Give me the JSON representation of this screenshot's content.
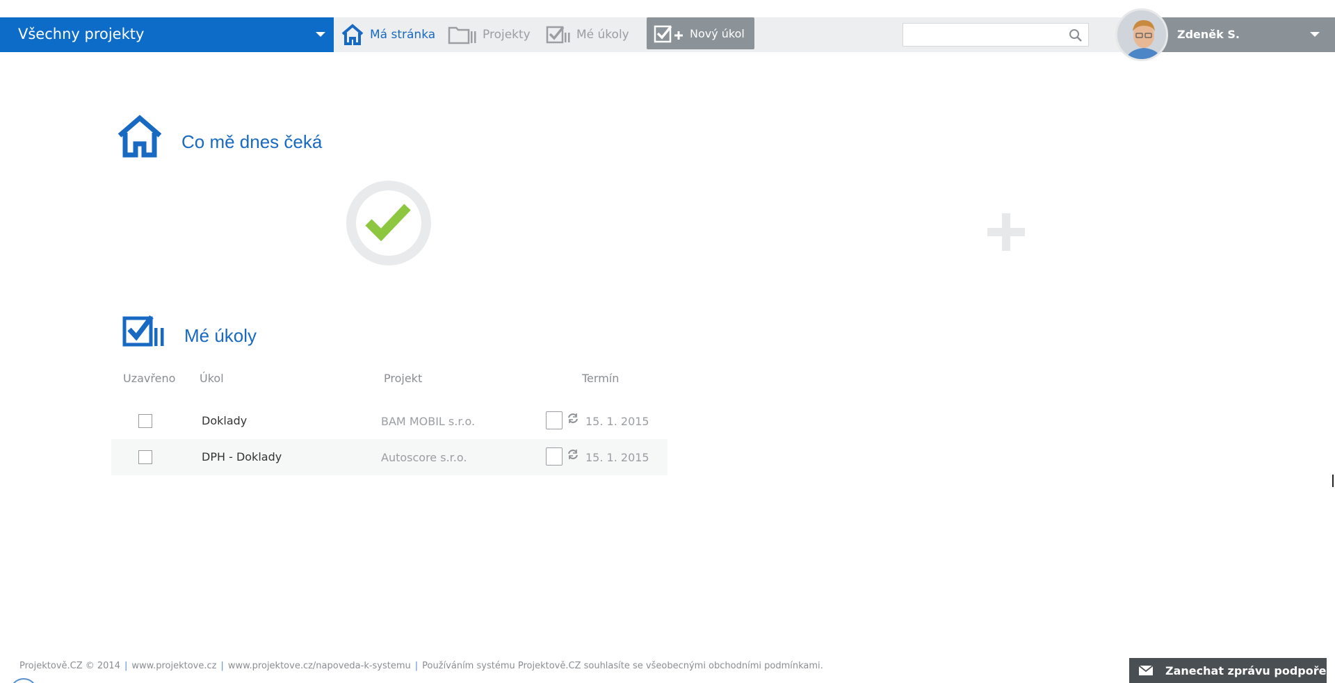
{
  "header": {
    "project_selector": "Všechny projekty",
    "nav": {
      "home": "Má stránka",
      "projects": "Projekty",
      "my_tasks": "Mé úkoly"
    },
    "new_task": "Nový úkol",
    "search": {
      "value": "",
      "placeholder": ""
    },
    "user_name": "Zdeněk S."
  },
  "today": {
    "title": "Co mě dnes čeká"
  },
  "tasks": {
    "title": "Mé úkoly",
    "columns": {
      "closed": "Uzavřeno",
      "task": "Úkol",
      "project": "Projekt",
      "deadline": "Termín"
    },
    "rows": [
      {
        "task": "Doklady",
        "project": "BAM MOBIL s.r.o.",
        "deadline": "15. 1. 2015"
      },
      {
        "task": "DPH - Doklady",
        "project": "Autoscore s.r.o.",
        "deadline": "15. 1. 2015"
      }
    ]
  },
  "footer": {
    "copyright": "Projektově.CZ © 2014",
    "link1": "www.projektove.cz",
    "link2": "www.projektove.cz/napoveda-k-systemu",
    "terms": "Používáním systému Projektově.CZ souhlasíte se všeobecnými obchodními podmínkami.",
    "support": "Zanechat zprávu podpoře"
  },
  "colors": {
    "brand_blue": "#0c6cc8",
    "accent_green": "#8dc63f",
    "nav_gray": "#8a9297"
  }
}
